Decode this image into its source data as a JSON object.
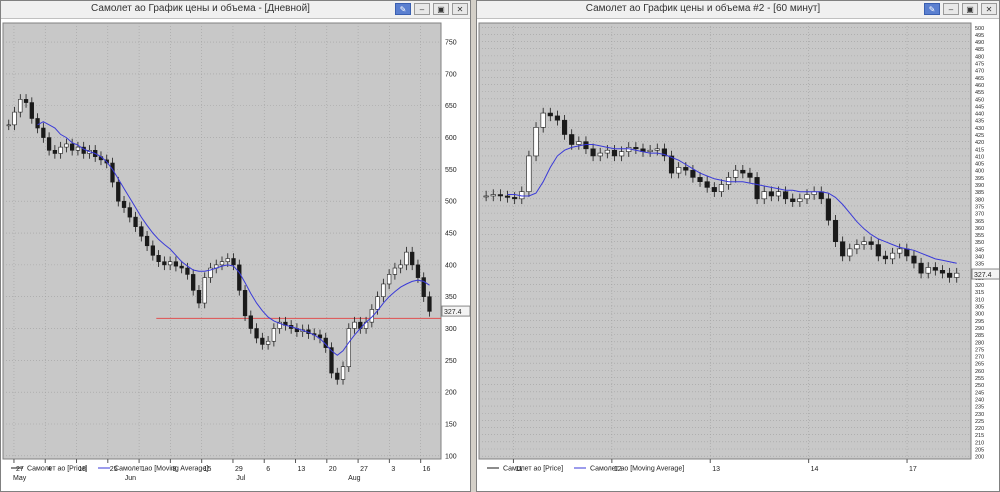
{
  "windows": [
    {
      "title": "Самолет ао График цены и объема - [Дневной]",
      "buttons": [
        "pin-icon",
        "minimize-icon",
        "restore-icon",
        "close-icon"
      ]
    },
    {
      "title": "Самолет ао График цены и объема #2 - [60 минут]",
      "buttons": [
        "pin-icon",
        "minimize-icon",
        "restore-icon",
        "close-icon"
      ]
    }
  ],
  "colors": {
    "candle": "#1a1a1a",
    "ma": "#3a3ad8",
    "level": "#e05050",
    "plot_bg": "#c8c8c8",
    "grid": "#a0a0a0"
  },
  "chart_data": [
    {
      "type": "candlestick",
      "title": "Самолет ао График цены и объема - [Дневной]",
      "ylim": [
        95,
        780
      ],
      "y_ticks": [
        100,
        150,
        200,
        250,
        300,
        350,
        400,
        450,
        500,
        550,
        600,
        650,
        700,
        750
      ],
      "x_ticks": [
        "27",
        "4",
        "18",
        "25",
        "1",
        "8",
        "15",
        "29",
        "6",
        "13",
        "20",
        "27",
        "3",
        "16"
      ],
      "x_months": [
        "May",
        "Jun",
        "Jul",
        "Aug"
      ],
      "last_price": "327.4",
      "level_line": 316,
      "legend": [
        "Самолет ао [Price]",
        "Самолет ао [Moving Average]"
      ],
      "close": [
        620,
        640,
        660,
        655,
        630,
        615,
        600,
        580,
        575,
        585,
        590,
        580,
        585,
        575,
        580,
        570,
        565,
        560,
        530,
        500,
        490,
        475,
        460,
        445,
        430,
        415,
        405,
        400,
        405,
        398,
        395,
        385,
        360,
        340,
        380,
        395,
        400,
        405,
        410,
        400,
        360,
        320,
        300,
        285,
        275,
        280,
        300,
        310,
        305,
        300,
        295,
        298,
        292,
        290,
        285,
        270,
        230,
        220,
        240,
        300,
        310,
        300,
        310,
        330,
        350,
        370,
        385,
        395,
        400,
        420,
        400,
        380,
        350,
        327
      ],
      "ma": [
        620,
        625,
        620,
        615,
        605,
        600,
        592,
        588,
        582,
        578,
        575,
        570,
        562,
        550,
        535,
        520,
        505,
        490,
        475,
        462,
        450,
        440,
        432,
        425,
        415,
        405,
        398,
        392,
        390,
        390,
        392,
        395,
        398,
        400,
        398,
        388,
        372,
        355,
        340,
        328,
        318,
        312,
        308,
        305,
        303,
        300,
        297,
        294,
        290,
        284,
        275,
        265,
        258,
        265,
        278,
        290,
        300,
        310,
        318,
        328,
        340,
        350,
        358,
        365,
        370,
        374,
        376,
        374,
        368
      ],
      "series_names": [
        "Самолет ао [Price]",
        "Самолет ао [Moving Average]"
      ]
    },
    {
      "type": "candlestick",
      "title": "Самолет ао График цены и объема #2 - [60 минут]",
      "ylim": [
        198,
        503
      ],
      "y_ticks": [
        200,
        205,
        210,
        215,
        220,
        225,
        230,
        235,
        240,
        245,
        250,
        255,
        260,
        265,
        270,
        275,
        280,
        285,
        290,
        295,
        300,
        305,
        310,
        315,
        320,
        325,
        330,
        335,
        340,
        345,
        350,
        355,
        360,
        365,
        370,
        375,
        380,
        385,
        390,
        395,
        400,
        405,
        410,
        415,
        420,
        425,
        430,
        435,
        440,
        445,
        450,
        455,
        460,
        465,
        470,
        475,
        480,
        485,
        490,
        495,
        500
      ],
      "x_ticks": [
        "11",
        "12",
        "13",
        "14",
        "17"
      ],
      "last_price": "327.4",
      "legend": [
        "Самолет ао [Price]",
        "Самолет ао [Moving Average]"
      ],
      "close": [
        382,
        383,
        382,
        381,
        380,
        385,
        410,
        430,
        440,
        438,
        435,
        425,
        418,
        420,
        415,
        410,
        412,
        414,
        410,
        413,
        416,
        415,
        413,
        414,
        415,
        410,
        398,
        402,
        400,
        395,
        392,
        388,
        385,
        390,
        395,
        400,
        398,
        395,
        380,
        385,
        382,
        385,
        380,
        378,
        380,
        383,
        385,
        380,
        365,
        350,
        340,
        345,
        348,
        350,
        348,
        340,
        338,
        342,
        345,
        340,
        335,
        328,
        332,
        330,
        328,
        325,
        328
      ],
      "ma": [
        383,
        383,
        382,
        382,
        384,
        392,
        402,
        410,
        414,
        416,
        417,
        418,
        418,
        417,
        416,
        415,
        415,
        415,
        414,
        413,
        412,
        412,
        411,
        409,
        407,
        404,
        401,
        398,
        396,
        394,
        393,
        392,
        392,
        392,
        391,
        390,
        389,
        388,
        387,
        386,
        386,
        385,
        385,
        385,
        385,
        384,
        381,
        376,
        370,
        364,
        359,
        355,
        352,
        350,
        348,
        346,
        345,
        344,
        342,
        340,
        338,
        337,
        336,
        335
      ],
      "series_names": [
        "Самолет ао [Price]",
        "Самолет ао [Moving Average]"
      ]
    }
  ]
}
